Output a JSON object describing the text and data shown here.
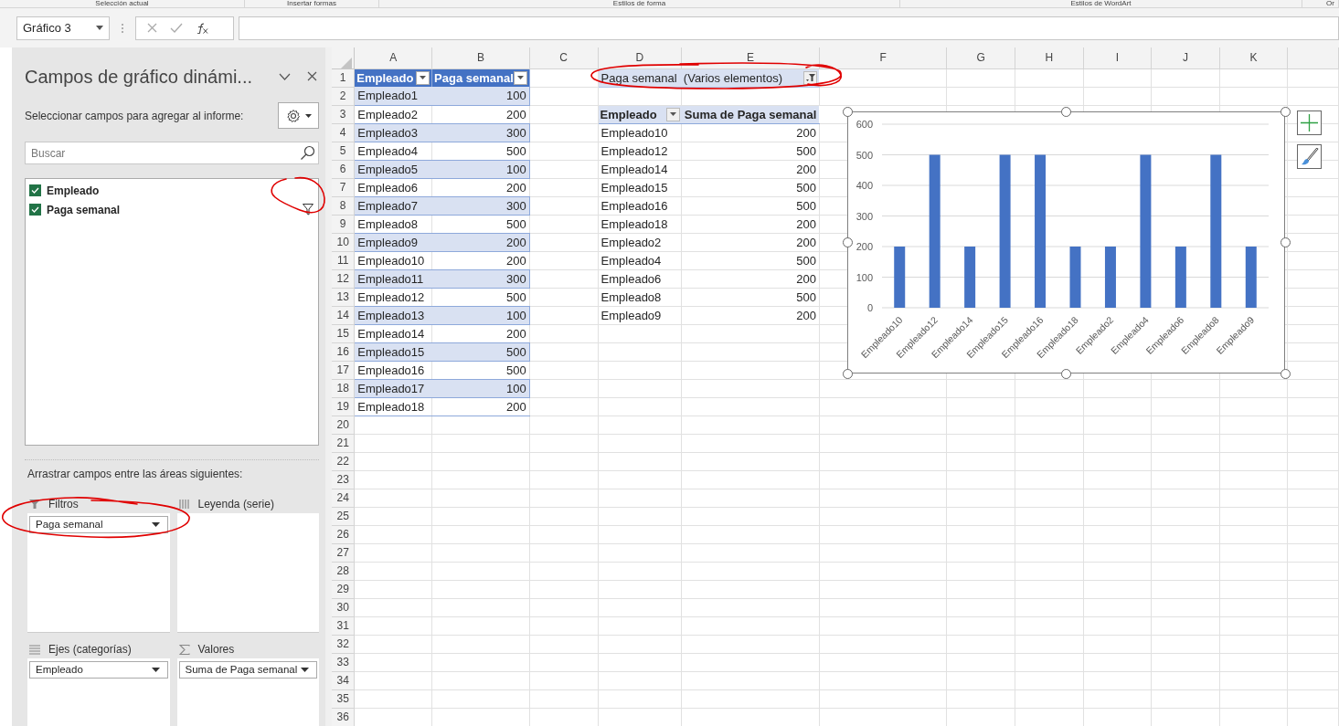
{
  "ribbon_groups": [
    "Selección actual",
    "Insertar formas",
    "Estilos de forma",
    "Estilos de WordArt",
    "Or"
  ],
  "name_box": {
    "value": "Gráfico 3"
  },
  "field_pane": {
    "title": "Campos de gráfico dinámi...",
    "subtitle": "Seleccionar campos para agregar al informe:",
    "search": {
      "placeholder": "Buscar"
    },
    "fields": [
      {
        "label": "Empleado",
        "checked": true,
        "filtered": false
      },
      {
        "label": "Paga semanal",
        "checked": true,
        "filtered": true
      }
    ],
    "areas_hint": "Arrastrar campos entre las áreas siguientes:",
    "areas": [
      {
        "kind": "filter",
        "label": "Filtros",
        "items": [
          "Paga semanal"
        ]
      },
      {
        "kind": "legend",
        "label": "Leyenda (serie)"
      },
      {
        "kind": "axis",
        "label": "Ejes (categorías)",
        "items": [
          "Empleado"
        ]
      },
      {
        "kind": "values",
        "label": "Valores",
        "items": [
          "Suma de Paga semanal"
        ]
      }
    ]
  },
  "sheet": {
    "columns": [
      "A",
      "B",
      "C",
      "D",
      "E",
      "F",
      "G",
      "H",
      "I",
      "J",
      "K"
    ],
    "rows": [
      "1",
      "2",
      "3",
      "4",
      "5",
      "6",
      "7",
      "8",
      "9",
      "10",
      "11",
      "12",
      "13",
      "14",
      "15",
      "16",
      "17",
      "18",
      "19",
      "20",
      "21",
      "22",
      "23",
      "24",
      "25",
      "26",
      "27",
      "28",
      "29",
      "30",
      "31",
      "32",
      "33",
      "34",
      "35",
      "36"
    ]
  },
  "source_table": {
    "columns": [
      "Empleado",
      "Paga semanal"
    ],
    "rows": [
      [
        "Empleado1",
        "100"
      ],
      [
        "Empleado2",
        "200"
      ],
      [
        "Empleado3",
        "300"
      ],
      [
        "Empleado4",
        "500"
      ],
      [
        "Empleado5",
        "100"
      ],
      [
        "Empleado6",
        "200"
      ],
      [
        "Empleado7",
        "300"
      ],
      [
        "Empleado8",
        "500"
      ],
      [
        "Empleado9",
        "200"
      ],
      [
        "Empleado10",
        "200"
      ],
      [
        "Empleado11",
        "300"
      ],
      [
        "Empleado12",
        "500"
      ],
      [
        "Empleado13",
        "100"
      ],
      [
        "Empleado14",
        "200"
      ],
      [
        "Empleado15",
        "500"
      ],
      [
        "Empleado16",
        "500"
      ],
      [
        "Empleado17",
        "100"
      ],
      [
        "Empleado18",
        "200"
      ]
    ]
  },
  "pivot": {
    "filter_field": "Paga semanal",
    "filter_value": "(Varios elementos)",
    "columns": [
      "Empleado",
      "Suma de Paga semanal"
    ],
    "rows": [
      [
        "Empleado10",
        "200"
      ],
      [
        "Empleado12",
        "500"
      ],
      [
        "Empleado14",
        "200"
      ],
      [
        "Empleado15",
        "500"
      ],
      [
        "Empleado16",
        "500"
      ],
      [
        "Empleado18",
        "200"
      ],
      [
        "Empleado2",
        "200"
      ],
      [
        "Empleado4",
        "500"
      ],
      [
        "Empleado6",
        "200"
      ],
      [
        "Empleado8",
        "500"
      ],
      [
        "Empleado9",
        "200"
      ]
    ]
  },
  "chart": {
    "chart_data": {
      "type": "bar",
      "categories": [
        "Empleado10",
        "Empleado12",
        "Empleado14",
        "Empleado15",
        "Empleado16",
        "Empleado18",
        "Empleado2",
        "Empleado4",
        "Empleado6",
        "Empleado8",
        "Empleado9"
      ],
      "series": [
        {
          "color": "#4472c4",
          "values": [
            200,
            500,
            200,
            500,
            500,
            200,
            200,
            500,
            200,
            500,
            200
          ]
        }
      ],
      "grid": true,
      "ylim": [
        0,
        600
      ],
      "yticks": [
        0,
        100,
        200,
        300,
        400,
        500,
        600
      ]
    }
  }
}
